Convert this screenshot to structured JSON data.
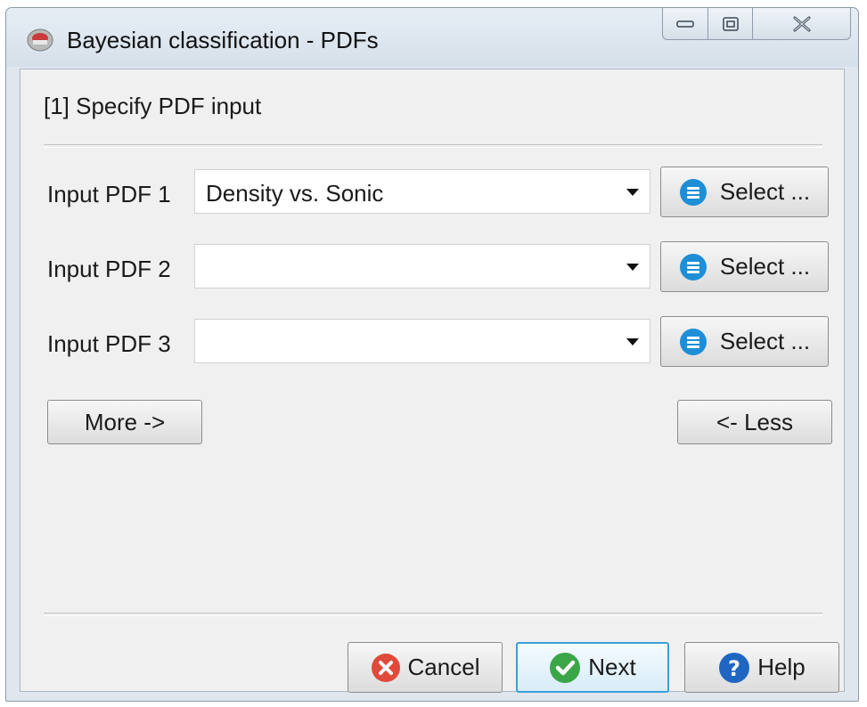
{
  "window": {
    "title": "Bayesian classification - PDFs"
  },
  "step": {
    "title": "[1] Specify PDF input"
  },
  "inputs": [
    {
      "label": "Input PDF 1",
      "value": "Density vs. Sonic",
      "select_label": "Select ..."
    },
    {
      "label": "Input PDF 2",
      "value": "",
      "select_label": "Select ..."
    },
    {
      "label": "Input PDF 3",
      "value": "",
      "select_label": "Select ..."
    }
  ],
  "more_label": "More ->",
  "less_label": "<- Less",
  "footer": {
    "cancel_label": "Cancel",
    "next_label": "Next",
    "help_label": "Help"
  },
  "icons": {
    "app": "app-logo-icon",
    "select": "list-icon",
    "cancel": "cancel-x-icon",
    "next": "checkmark-icon",
    "help": "question-mark-icon"
  },
  "colors": {
    "select_icon": "#1e8fd6",
    "cancel_icon": "#e04a3a",
    "next_icon": "#3aa648",
    "help_icon": "#1f66c2",
    "default_button_border": "#3aa0d8"
  }
}
